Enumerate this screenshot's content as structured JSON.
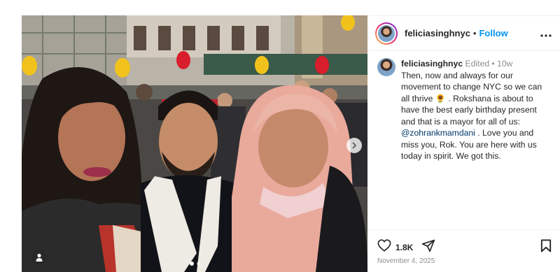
{
  "post": {
    "username": "feliciasinghnyc",
    "follow_separator": "•",
    "follow_label": "Follow",
    "more_icon": "more-horizontal-icon",
    "caption": {
      "username": "feliciasinghnyc",
      "edited_label": "Edited",
      "meta_separator": "•",
      "age": "10w",
      "text_before_mention": "Then, now and always for our movement to change NYC so we can all thrive 🌻 . Rokshana is about to have the best early birthday present and that is a mayor for all of us: ",
      "mention": "@zohrankmamdani",
      "text_after_mention": " . Love you and miss you, Rok. You are here with us today in spirit. We got this."
    },
    "likes": "1.8K",
    "date": "November 4, 2025",
    "carousel": {
      "total": 2,
      "active_index": 0
    }
  },
  "colors": {
    "follow": "#0095f6",
    "mention": "#00376b",
    "meta": "#8e8e8e",
    "text": "#262626"
  }
}
